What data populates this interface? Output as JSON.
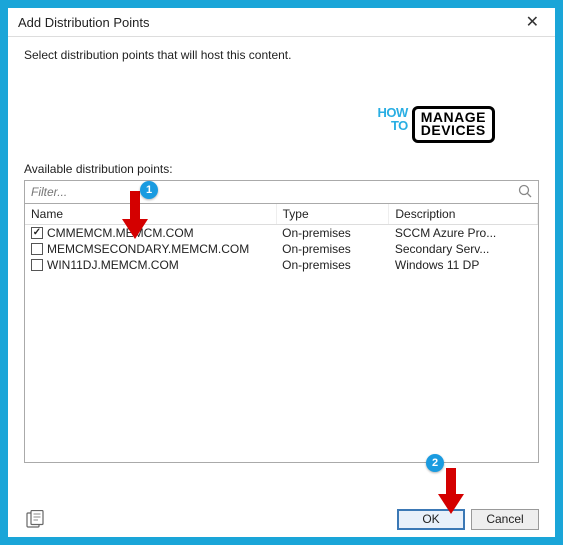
{
  "dialog": {
    "title": "Add Distribution Points",
    "close_symbol": "✕",
    "instruction": "Select distribution points that will host this content."
  },
  "watermark": {
    "how": "HOW",
    "to": "TO",
    "manage": "MANAGE",
    "devices": "DEVICES"
  },
  "available": {
    "label": "Available distribution points:"
  },
  "filter": {
    "placeholder": "Filter...",
    "search_glyph": "🔍"
  },
  "table": {
    "headers": {
      "name": "Name",
      "type": "Type",
      "description": "Description"
    },
    "rows": [
      {
        "checked": true,
        "name": "CMMEMCM.MEMCM.COM",
        "type": "On-premises",
        "description": "SCCM Azure Pro..."
      },
      {
        "checked": false,
        "name": "MEMCMSECONDARY.MEMCM.COM",
        "type": "On-premises",
        "description": "Secondary Serv..."
      },
      {
        "checked": false,
        "name": "WIN11DJ.MEMCM.COM",
        "type": "On-premises",
        "description": "Windows 11 DP"
      }
    ]
  },
  "buttons": {
    "ok": "OK",
    "cancel": "Cancel"
  },
  "annotations": {
    "badge1": "1",
    "badge2": "2"
  }
}
